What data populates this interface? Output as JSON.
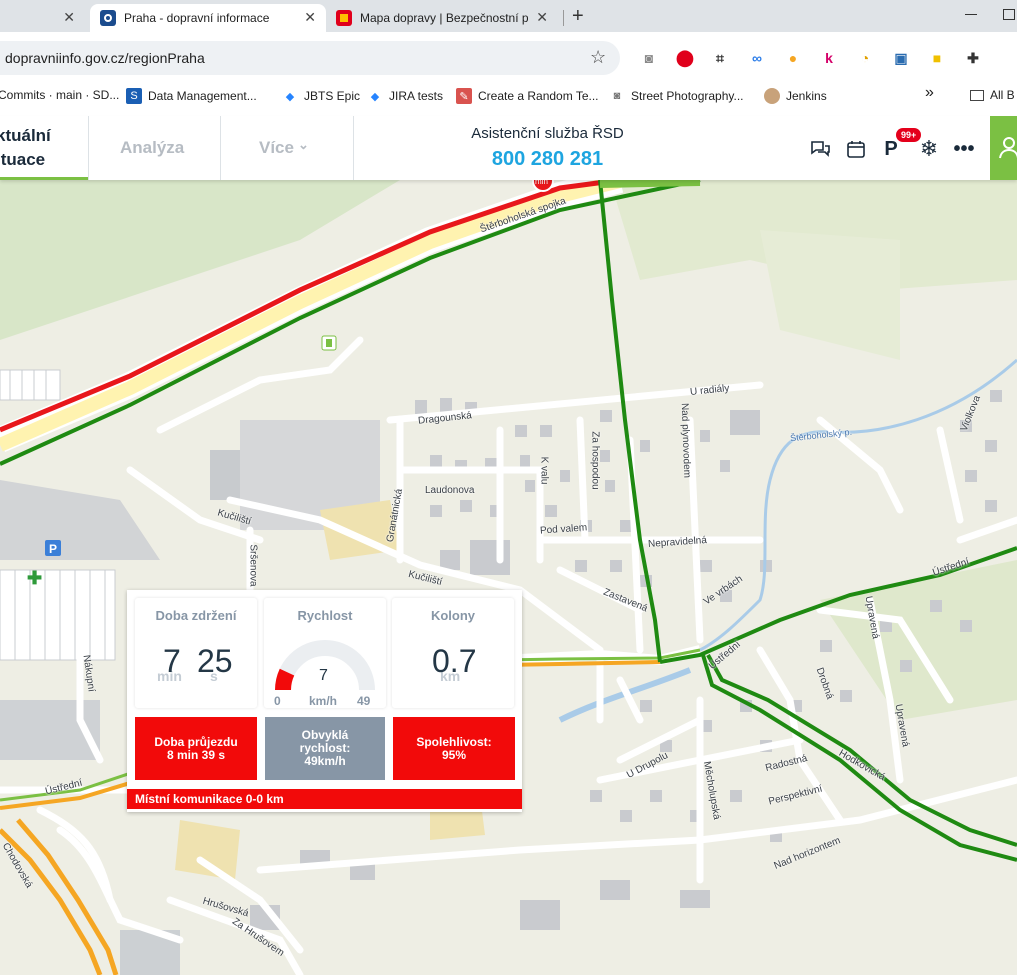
{
  "browser": {
    "tabs": [
      {
        "title": "",
        "close": "✕"
      },
      {
        "title": "Praha - dopravní informace",
        "close": "✕"
      },
      {
        "title": "Mapa dopravy | Bezpečnostní p",
        "close": "✕"
      }
    ],
    "new_tab": "+",
    "url": "dopravniinfo.gov.cz/regionPraha",
    "bookmarks": [
      "Commits · main · SD...",
      "Data Management...",
      "JBTS Epic",
      "JIRA tests",
      "Create a Random Te...",
      "Street Photography...",
      "Jenkins"
    ],
    "bookmarks_more": "»",
    "all_bookmarks": "All B",
    "colors": {
      "tab_bar": "#dfe3e7",
      "jira_blue": "#2684ff",
      "opera_red": "#e0001b"
    }
  },
  "header": {
    "nav_actual_line1": "ktuální",
    "nav_actual_line2": "ituace",
    "nav_analyza": "Analýza",
    "nav_vice": "Více",
    "assist_label": "Asistenční služba ŘSD",
    "assist_phone": "800 280 281",
    "badge": "99+",
    "icons": [
      "chat-icon",
      "calendar-icon",
      "question-icon",
      "snowflake-icon",
      "more-icon",
      "user-icon"
    ],
    "colors": {
      "accent_green": "#7bc043",
      "phone_blue": "#1ea5e0"
    }
  },
  "map": {
    "min_badge": "min",
    "labels": {
      "sterbo_spojka": "Štěrboholská spojka",
      "u_radialy": "U radiály",
      "dragounska": "Dragounská",
      "k_valu": "K valu",
      "za_hospodou": "Za hospodou",
      "nad_plynovodem": "Nad plynovodem",
      "sterbo_p": "Štěrboholský p.",
      "violkova": "Violkova",
      "laudonova": "Laudonova",
      "granatnicka": "Granátnická",
      "kucilisti_1": "Kučiliští",
      "kucilisti_2": "Kučiliští",
      "sersenova": "Sršenova",
      "pod_valem": "Pod valem",
      "nepravidelna": "Nepravidelná",
      "zastavena": "Zastavená",
      "ve_vrbach": "Ve vrbách",
      "ustredni_1": "Ústřední",
      "ustredni_2": "Ústřední",
      "ustredni_3": "Ústřední",
      "upravena_1": "Upravená",
      "upravena_2": "Upravená",
      "drobna": "Drobná",
      "nakupni": "Nákupní",
      "u_drupolu": "U Drupolu",
      "mecholupska": "Měcholupská",
      "radostna": "Radostná",
      "perspektivni": "Perspektivní",
      "nad_horizontem": "Nad horizontem",
      "hrusovska": "Hrušovská",
      "za_hrusovem": "Za Hrušovem",
      "chodovska": "Chodovská",
      "hodkovicka": "Hodkovická"
    },
    "colors": {
      "base": "#eeeee4",
      "green_route": "#1f8a12",
      "red_route": "#e8171b",
      "orange_route": "#f5a623",
      "water": "#a9cbe8"
    }
  },
  "popup": {
    "delay": {
      "title": "Doba zdržení",
      "minutes": "7",
      "seconds": "25",
      "min_unit": "min",
      "sec_unit": "s"
    },
    "speed": {
      "title": "Rychlost",
      "value": "7",
      "unit": "km/h",
      "min": "0",
      "max": "49",
      "gauge_fraction": 0.14
    },
    "queues": {
      "title": "Kolony",
      "value": "0.7",
      "unit": "km"
    },
    "travel_time": {
      "line1": "Doba průjezdu",
      "line2": "8 min 39 s"
    },
    "usual_speed": {
      "line1": "Obvyklá",
      "line2": "rychlost:",
      "line3": "49km/h"
    },
    "reliability": {
      "line1": "Spolehlivost:",
      "line2": "95%"
    },
    "footer": "Místní komunikace 0-0 km",
    "colors": {
      "alert_red": "#f20a0a",
      "muted_grey": "#8796a6"
    }
  }
}
